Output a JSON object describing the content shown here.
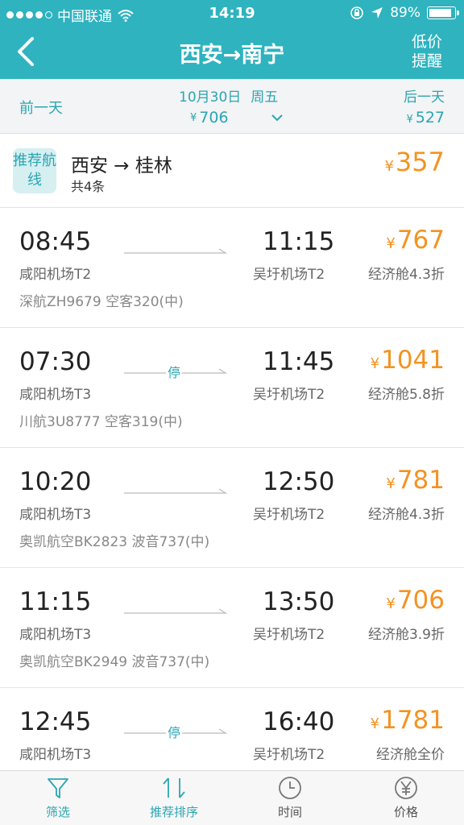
{
  "status": {
    "carrier": "中国联通",
    "time": "14:19",
    "battery": "89%",
    "battery_level": 0.89
  },
  "header": {
    "title": "西安→南宁",
    "alert_line1": "低价",
    "alert_line2": "提醒"
  },
  "datebar": {
    "prev": "前一天",
    "date": "10月30日",
    "weekday": "周五",
    "date_price": "706",
    "next": "后一天",
    "next_price": "527",
    "currency": "¥"
  },
  "recommend": {
    "badge": "推荐航线",
    "route": "西安 → 桂林",
    "count": "共4条",
    "price": "357"
  },
  "flights": [
    {
      "dep": "08:45",
      "arr": "11:15",
      "dep_apt": "咸阳机场T2",
      "arr_apt": "吴圩机场T2",
      "airline": "深航ZH9679  空客320(中)",
      "price": "767",
      "cabin": "经济舱4.3折",
      "stop": ""
    },
    {
      "dep": "07:30",
      "arr": "11:45",
      "dep_apt": "咸阳机场T3",
      "arr_apt": "吴圩机场T2",
      "airline": "川航3U8777  空客319(中)",
      "price": "1041",
      "cabin": "经济舱5.8折",
      "stop": "停"
    },
    {
      "dep": "10:20",
      "arr": "12:50",
      "dep_apt": "咸阳机场T3",
      "arr_apt": "吴圩机场T2",
      "airline": "奥凯航空BK2823  波音737(中)",
      "price": "781",
      "cabin": "经济舱4.3折",
      "stop": ""
    },
    {
      "dep": "11:15",
      "arr": "13:50",
      "dep_apt": "咸阳机场T3",
      "arr_apt": "吴圩机场T2",
      "airline": "奥凯航空BK2949  波音737(中)",
      "price": "706",
      "cabin": "经济舱3.9折",
      "stop": ""
    },
    {
      "dep": "12:45",
      "arr": "16:40",
      "dep_apt": "咸阳机场T3",
      "arr_apt": "吴圩机场T2",
      "airline": "",
      "price": "1781",
      "cabin": "经济舱全价",
      "stop": "停"
    }
  ],
  "tabs": [
    {
      "label": "筛选",
      "icon": "filter-icon"
    },
    {
      "label": "推荐排序",
      "icon": "sort-icon"
    },
    {
      "label": "时间",
      "icon": "clock-icon"
    },
    {
      "label": "价格",
      "icon": "yen-icon"
    }
  ],
  "colors": {
    "accent": "#2eb3bf",
    "price": "#f39322"
  }
}
